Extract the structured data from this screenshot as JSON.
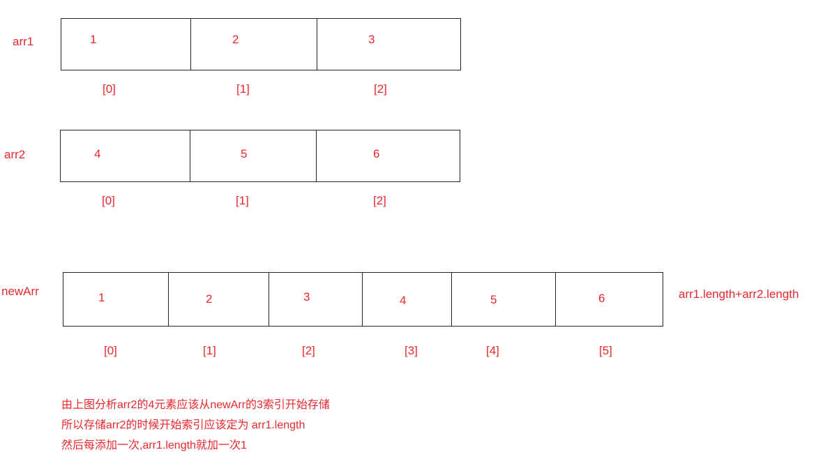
{
  "arr1": {
    "name": "arr1",
    "values": [
      "1",
      "2",
      "3"
    ],
    "indices": [
      "[0]",
      "[1]",
      "[2]"
    ]
  },
  "arr2": {
    "name": "arr2",
    "values": [
      "4",
      "5",
      "6"
    ],
    "indices": [
      "[0]",
      "[1]",
      "[2]"
    ]
  },
  "newArr": {
    "name": "newArr",
    "values": [
      "1",
      "2",
      "3",
      "4",
      "5",
      "6"
    ],
    "indices": [
      "[0]",
      "[1]",
      "[2]",
      "[3]",
      "[4]",
      "[5]"
    ],
    "length_note": "arr1.length+arr2.length"
  },
  "notes": [
    "由上图分析arr2的4元素应该从newArr的3索引开始存储",
    "所以存储arr2的时候开始索引应该定为 arr1.length",
    "然后每添加一次,arr1.length就加一次1"
  ],
  "colors": {
    "text": "#e8282e",
    "border": "#222222",
    "background": "#ffffff"
  }
}
